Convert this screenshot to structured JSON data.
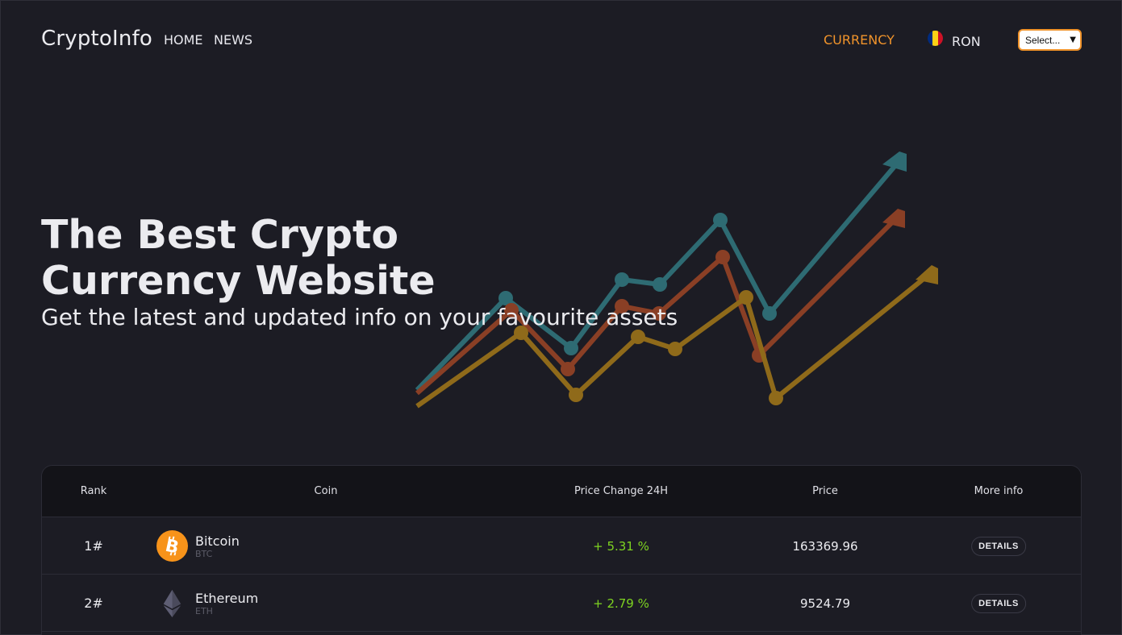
{
  "header": {
    "brand": "CryptoInfo",
    "nav": [
      {
        "label": "HOME"
      },
      {
        "label": "NEWS"
      }
    ],
    "currency_label": "CURRENCY",
    "selected_currency": "RON",
    "flag_colors": [
      "#002b7f",
      "#fcd116",
      "#ce1126"
    ],
    "select_label": "Select..."
  },
  "hero": {
    "title": "The Best Crypto Currency Website",
    "subtitle": "Get the latest and updated info on your favourite assets"
  },
  "table": {
    "columns": [
      "Rank",
      "Coin",
      "Price Change 24H",
      "Price",
      "More info"
    ],
    "rows": [
      {
        "rank": "1#",
        "name": "Bitcoin",
        "symbol": "BTC",
        "change": "+ 5.31 %",
        "price": "163369.96",
        "action": "DETAILS",
        "icon": "bitcoin-icon"
      },
      {
        "rank": "2#",
        "name": "Ethereum",
        "symbol": "ETH",
        "change": "+ 2.79 %",
        "price": "9524.79",
        "action": "DETAILS",
        "icon": "ethereum-icon"
      }
    ]
  },
  "colors": {
    "accent": "#f0932b",
    "positive": "#7ed321",
    "background": "#1c1c24",
    "chart_teal": "#2e6b73",
    "chart_rust": "#8a3f25",
    "chart_gold": "#8f6a1a"
  }
}
